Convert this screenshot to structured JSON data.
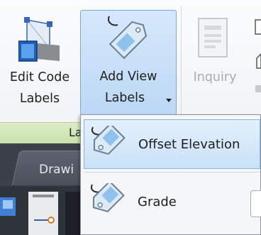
{
  "ribbon": {
    "edit_code_labels": {
      "line1": "Edit Code",
      "line2": "Labels"
    },
    "add_view_labels": {
      "line1": "Add View",
      "line2": "Labels"
    },
    "inquiry": {
      "label": "Inquiry"
    },
    "panel_title": "La"
  },
  "drawing_tab": {
    "label": "Drawi"
  },
  "menu": {
    "items": [
      {
        "label": "Offset Elevation"
      },
      {
        "label": "Grade"
      }
    ]
  },
  "colors": {
    "accent": "#bcd8f5",
    "panel_strip": "#c7e0a8",
    "dark_bg": "#3b4049"
  }
}
